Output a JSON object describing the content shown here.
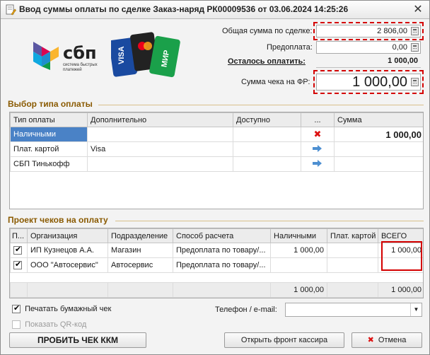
{
  "window": {
    "title": "Ввод суммы оплаты по сделке Заказ-наряд РК00009536 от 03.06.2024 14:25:26"
  },
  "logos": {
    "sbp_main": "сбп",
    "sbp_sub": "система быстрых платежей"
  },
  "summary": {
    "total_label": "Общая сумма по сделке:",
    "total_value": "2 806,00",
    "prepay_label": "Предоплата:",
    "prepay_value": "0,00",
    "remaining_label": "Осталось оплатить:",
    "remaining_value": "1 000,00",
    "receipt_label": "Сумма чека на ФР:",
    "receipt_value": "1 000,00"
  },
  "payment_types": {
    "section_title": "Выбор типа оплаты",
    "columns": [
      "Тип оплаты",
      "Дополнительно",
      "Доступно",
      "...",
      "Сумма"
    ],
    "rows": [
      {
        "type": "Наличными",
        "extra": "",
        "available": "",
        "action_icon": "delete-icon",
        "sum": "1 000,00"
      },
      {
        "type": "Плат. картой",
        "extra": "Visa",
        "available": "",
        "action_icon": "arrow-right-icon",
        "sum": ""
      },
      {
        "type": "СБП Тинькофф",
        "extra": "",
        "available": "",
        "action_icon": "arrow-right-icon",
        "sum": ""
      }
    ]
  },
  "receipts": {
    "section_title": "Проект чеков на оплату",
    "columns": [
      "П...",
      "Организация",
      "Подразделение",
      "Способ расчета",
      "Наличными",
      "Плат. картой",
      "ВСЕГО"
    ],
    "rows": [
      {
        "checked": true,
        "org": "ИП Кузнецов А.А.",
        "dept": "Магазин",
        "method": "Предоплата по товару/...",
        "cash": "1 000,00",
        "card": "",
        "total": "1 000,00"
      },
      {
        "checked": true,
        "org": "ООО \"Автосервис\"",
        "dept": "Автосервис",
        "method": "Предоплата по товару/...",
        "cash": "",
        "card": "",
        "total": ""
      }
    ],
    "footer": {
      "cash": "1 000,00",
      "card": "",
      "total": "1 000,00"
    }
  },
  "options": {
    "print_paper_label": "Печатать бумажный чек",
    "print_paper_checked": true,
    "show_qr_label": "Показать QR-код",
    "show_qr_checked": false,
    "phone_label": "Телефон / e-mail:",
    "phone_value": ""
  },
  "buttons": {
    "punch": "ПРОБИТЬ ЧЕК ККМ",
    "front": "Открыть фронт кассира",
    "cancel": "Отмена"
  },
  "colors": {
    "selection": "#4a82c6",
    "highlight_red": "#d40000",
    "section_title": "#8a5a00"
  }
}
